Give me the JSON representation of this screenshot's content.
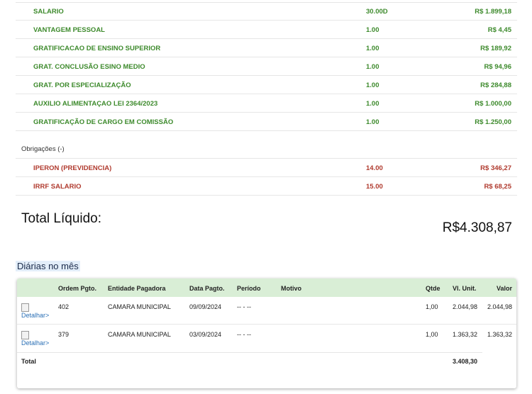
{
  "earnings": [
    {
      "name": "SALARIO",
      "qty": "30.00D",
      "value": "R$ 1.899,18"
    },
    {
      "name": "VANTAGEM PESSOAL",
      "qty": "1.00",
      "value": "R$ 4,45"
    },
    {
      "name": "GRATIFICACAO DE ENSINO SUPERIOR",
      "qty": "1.00",
      "value": "R$ 189,92"
    },
    {
      "name": "GRAT. CONCLUSÃO ESINO MEDIO",
      "qty": "1.00",
      "value": "R$ 94,96"
    },
    {
      "name": "GRAT. POR ESPECIALIZAÇÃO",
      "qty": "1.00",
      "value": "R$ 284,88"
    },
    {
      "name": "AUXILIO ALIMENTAÇAO LEI 2364/2023",
      "qty": "1.00",
      "value": "R$ 1.000,00"
    },
    {
      "name": "GRATIFICAÇÃO DE CARGO EM COMISSÃO",
      "qty": "1.00",
      "value": "R$ 1.250,00"
    }
  ],
  "obligations_label": "Obrigações (-)",
  "deductions": [
    {
      "name": "IPERON (PREVIDENCIA)",
      "qty": "14.00",
      "value": "R$ 346,27"
    },
    {
      "name": "IRRF SALARIO",
      "qty": "15.00",
      "value": "R$ 68,25"
    }
  ],
  "total_liquido": {
    "label": "Total Líquido:",
    "value": "R$4.308,87"
  },
  "diarias": {
    "title": "Diárias no mês",
    "headers": {
      "ordem": "Ordem Pgto.",
      "entidade": "Entidade Pagadora",
      "data": "Data Pagto.",
      "periodo": "Período",
      "motivo": "Motivo",
      "qtde": "Qtde",
      "vl_unit": "Vl. Unit.",
      "valor": "Valor"
    },
    "rows": [
      {
        "detail": "Detalhar>",
        "ordem": "402",
        "entidade": "CAMARA MUNICIPAL",
        "data": "09/09/2024",
        "periodo": "-- - --",
        "qtde": "1,00",
        "vl_unit": "2.044,98",
        "valor": "2.044,98"
      },
      {
        "detail": "Detalhar>",
        "ordem": "379",
        "entidade": "CAMARA MUNICIPAL",
        "data": "03/09/2024",
        "periodo": "-- - --",
        "qtde": "1,00",
        "vl_unit": "1.363,32",
        "valor": "1.363,32"
      }
    ],
    "total_label": "Total",
    "total_value": "3.408,30"
  },
  "colors": {
    "earning": "#3d8a2c",
    "deduction": "#b03a2e",
    "header_bg": "#d9eed6",
    "link": "#2a6fb5"
  }
}
